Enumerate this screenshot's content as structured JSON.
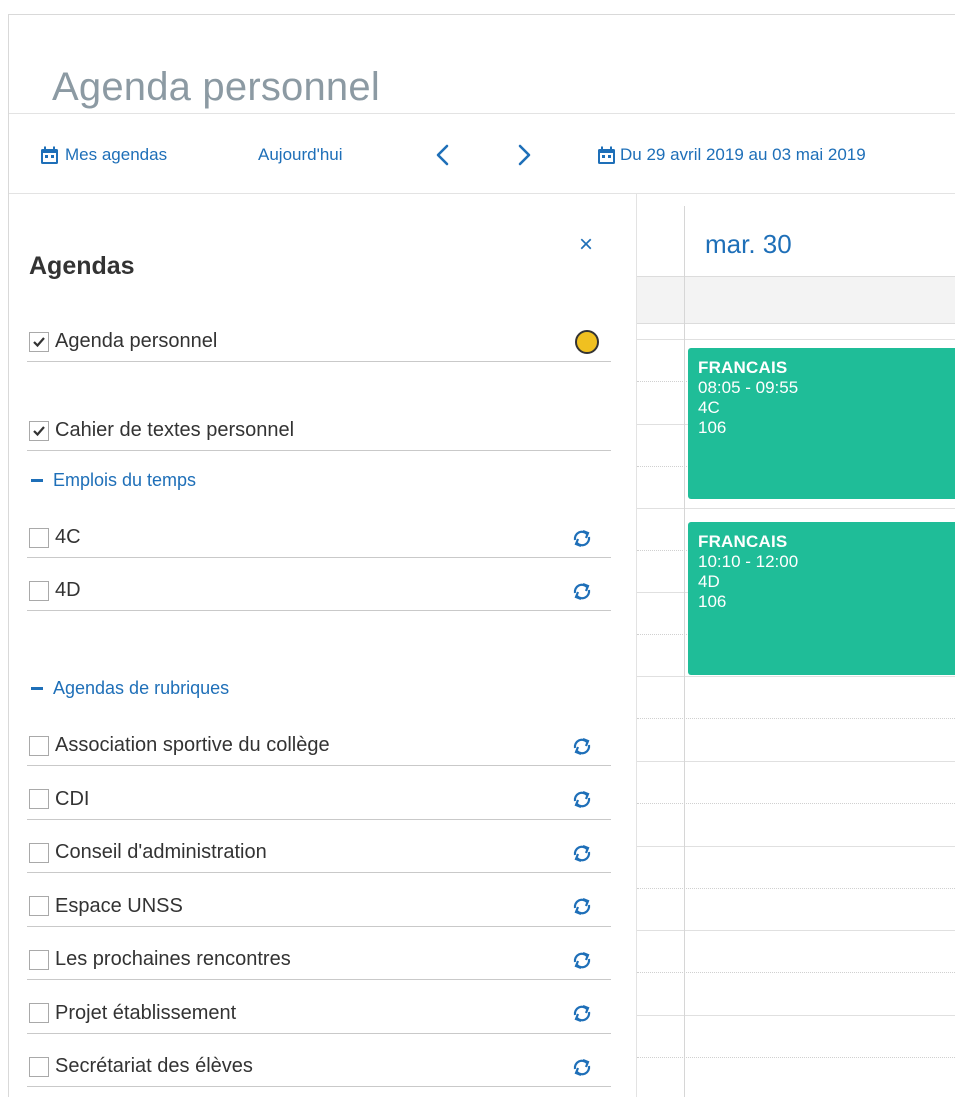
{
  "page": {
    "title": "Agenda personnel"
  },
  "toolbar": {
    "my_agendas": "Mes agendas",
    "today": "Aujourd'hui",
    "date_range": "Du 29 avril 2019 au 03 mai 2019"
  },
  "sidebar": {
    "heading": "Agendas",
    "close_label": "×",
    "personal": [
      {
        "label": "Agenda personnel",
        "checked": true,
        "color": "#f0c020"
      },
      {
        "label": "Cahier de textes personnel",
        "checked": true
      }
    ],
    "timetables": {
      "toggle_label": "Emplois du temps",
      "items": [
        {
          "label": "4C"
        },
        {
          "label": "4D"
        }
      ]
    },
    "topics": {
      "toggle_label": "Agendas de rubriques",
      "items": [
        {
          "label": "Association sportive du collège"
        },
        {
          "label": "CDI"
        },
        {
          "label": "Conseil d'administration"
        },
        {
          "label": "Espace UNSS"
        },
        {
          "label": "Les prochaines rencontres"
        },
        {
          "label": "Projet établissement"
        },
        {
          "label": "Secrétariat des élèves"
        }
      ]
    }
  },
  "calendar": {
    "day_label": "mar. 30",
    "events": [
      {
        "title": "FRANCAIS",
        "time": "08:05 - 09:55",
        "class": "4C",
        "room": "106"
      },
      {
        "title": "FRANCAIS",
        "time": "10:10 - 12:00",
        "class": "4D",
        "room": "106"
      }
    ],
    "event_color": "#1fbd98"
  },
  "colors": {
    "accent": "#1e6fb8",
    "title_gray": "#8c9aa3"
  }
}
